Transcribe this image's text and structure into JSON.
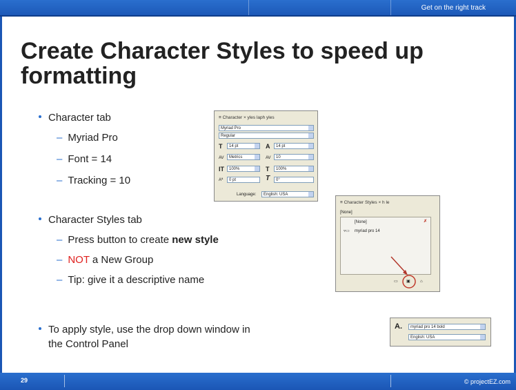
{
  "header": {
    "tagline": "Get on the right track"
  },
  "title": "Create Character Styles to speed up formatting",
  "bullets": [
    {
      "text": "Character tab",
      "subs": [
        "Myriad Pro",
        "Font = 14",
        "Tracking = 10"
      ]
    },
    {
      "text": "Character Styles tab",
      "subs": [
        {
          "before": "Press button to create ",
          "bold": "new style"
        },
        {
          "red": "NOT",
          "after": " a New Group"
        },
        {
          "text": "Tip: give it a descriptive name"
        }
      ]
    },
    {
      "text": "To apply style, use the drop down window in",
      "text2": "the Control Panel"
    }
  ],
  "character_panel": {
    "tabs": "≡ Character ×  yles  laph  yles",
    "font": "Myriad Pro",
    "style": "Regular",
    "size": "14 pt",
    "leading": "14 pt",
    "kerning": "Metrics",
    "tracking": "10",
    "vscale": "100%",
    "hscale": "100%",
    "baseline": "0 pt",
    "skew": "0°",
    "language_label": "Language:",
    "language": "English: USA"
  },
  "styles_panel": {
    "tabs": "≡ Character Styles ×  h  le",
    "current": "[None]",
    "none_item": "[None]",
    "style_item": "myriad pro 14"
  },
  "control_panel": {
    "style": "myriad pro 14 bold",
    "language": "English: USA"
  },
  "footer": {
    "page": "29",
    "copyright": "© projectEZ.com"
  }
}
